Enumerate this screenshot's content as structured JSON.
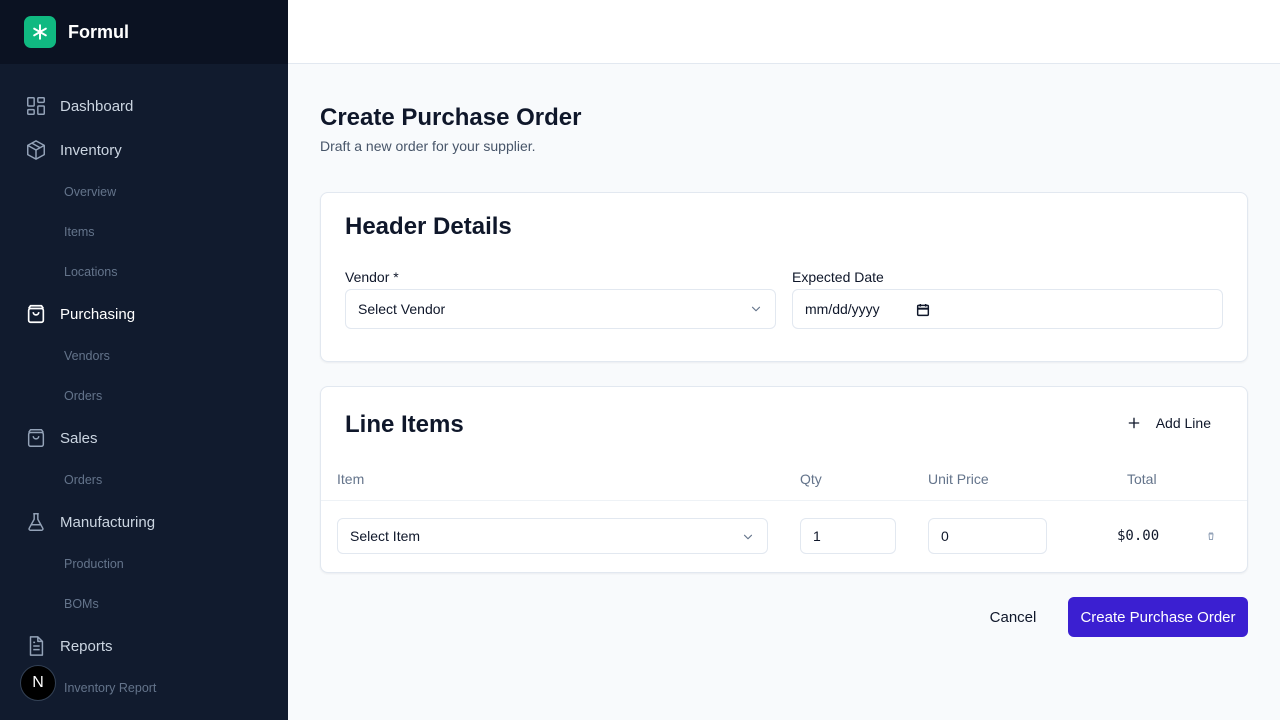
{
  "brand": {
    "name": "Formul",
    "logo_icon": "asterisk-icon",
    "accent": "#10b981"
  },
  "sidebar": {
    "sections": [
      {
        "label": "Dashboard",
        "icon": "dashboard-grid-icon",
        "subitems": []
      },
      {
        "label": "Inventory",
        "icon": "box-icon",
        "subitems": [
          "Overview",
          "Items",
          "Locations"
        ]
      },
      {
        "label": "Purchasing",
        "icon": "shopping-bag-icon",
        "active": true,
        "subitems": [
          "Vendors",
          "Orders"
        ]
      },
      {
        "label": "Sales",
        "icon": "shopping-bag-icon",
        "subitems": [
          "Orders"
        ]
      },
      {
        "label": "Manufacturing",
        "icon": "flask-icon",
        "subitems": [
          "Production",
          "BOMs"
        ]
      },
      {
        "label": "Reports",
        "icon": "document-icon",
        "subitems": [
          "Inventory Report"
        ]
      }
    ]
  },
  "user": {
    "avatar_initial": "N"
  },
  "page": {
    "title": "Create Purchase Order",
    "subtitle": "Draft a new order for your supplier."
  },
  "header_details": {
    "title": "Header Details",
    "vendor_label": "Vendor *",
    "vendor_value": "Select Vendor",
    "date_label": "Expected Date",
    "date_value": "mm/dd/yyyy"
  },
  "line_items": {
    "title": "Line Items",
    "add_line_label": "Add Line",
    "columns": [
      "Item",
      "Qty",
      "Unit Price",
      "Total"
    ],
    "rows": [
      {
        "item": "Select Item",
        "qty": "1",
        "unit_price": "0",
        "total": "$0.00"
      }
    ]
  },
  "actions": {
    "cancel_label": "Cancel",
    "submit_label": "Create Purchase Order",
    "submit_color": "#3b1fd1"
  }
}
